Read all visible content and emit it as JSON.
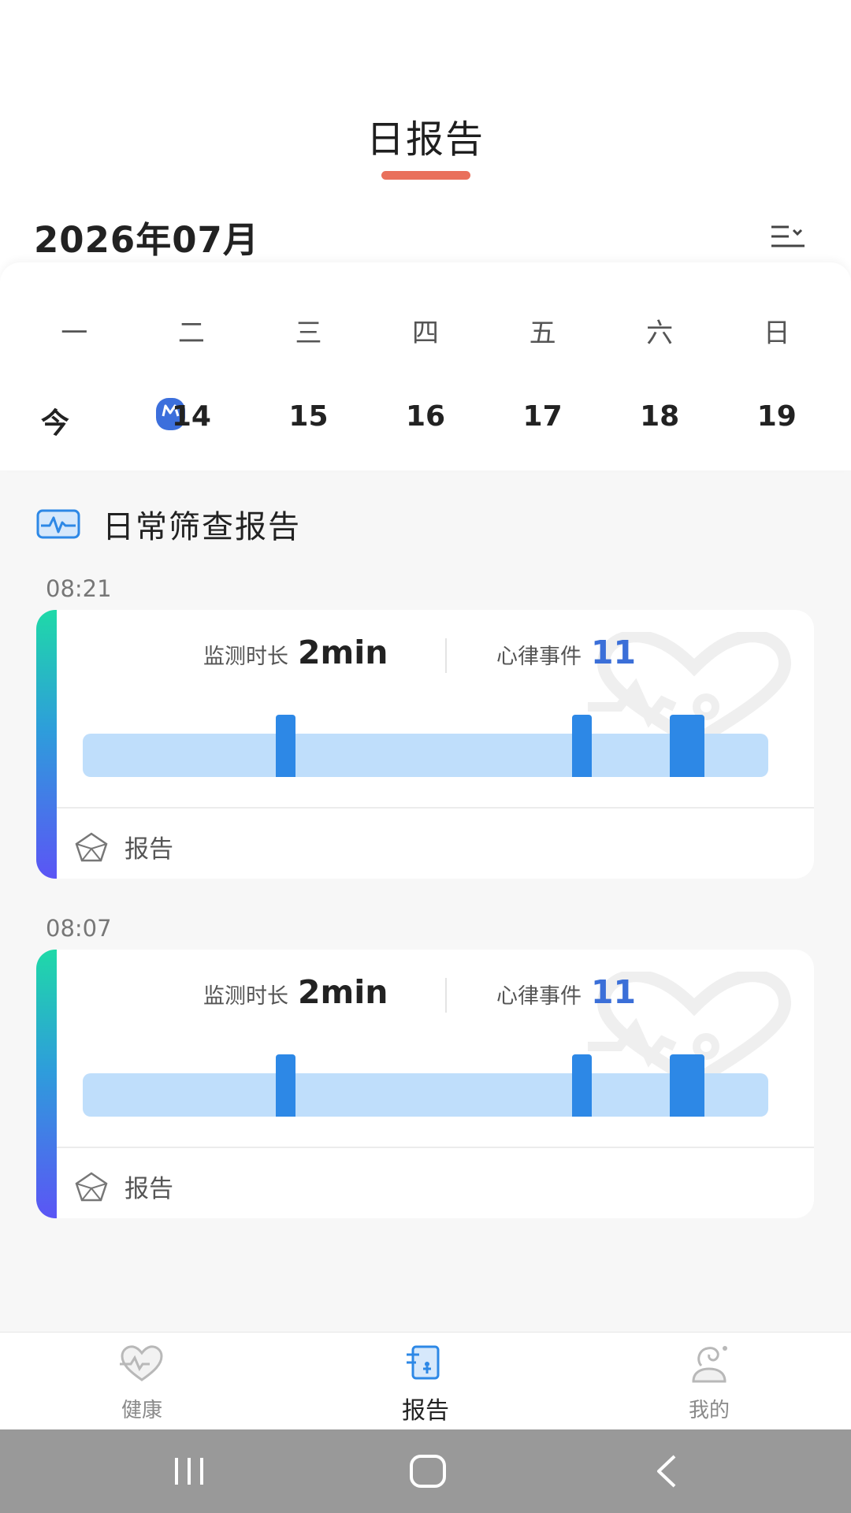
{
  "header": {
    "title": "日报告",
    "accent_color": "#e9705b"
  },
  "calendar": {
    "month": "2026年07月",
    "weekdays": [
      "一",
      "二",
      "三",
      "四",
      "五",
      "六",
      "日"
    ],
    "dates": [
      "今",
      "14",
      "15",
      "16",
      "17",
      "18",
      "19"
    ]
  },
  "section": {
    "title": "日常筛查报告"
  },
  "reports": [
    {
      "time": "08:21",
      "duration_label": "监测时长",
      "duration_value": "2min",
      "events_label": "心律事件",
      "events_value": "11",
      "link_label": "报告"
    },
    {
      "time": "08:07",
      "duration_label": "监测时长",
      "duration_value": "2min",
      "events_label": "心律事件",
      "events_value": "11",
      "link_label": "报告"
    }
  ],
  "bottom_nav": {
    "items": [
      {
        "label": "健康",
        "icon": "heart-icon"
      },
      {
        "label": "报告",
        "icon": "report-icon",
        "active": true
      },
      {
        "label": "我的",
        "icon": "profile-icon"
      }
    ]
  },
  "colors": {
    "event_bar": "#2d88e6",
    "track": "#bfdefb",
    "value_blue": "#3b6fd8",
    "today_red": "#e01f1f"
  }
}
